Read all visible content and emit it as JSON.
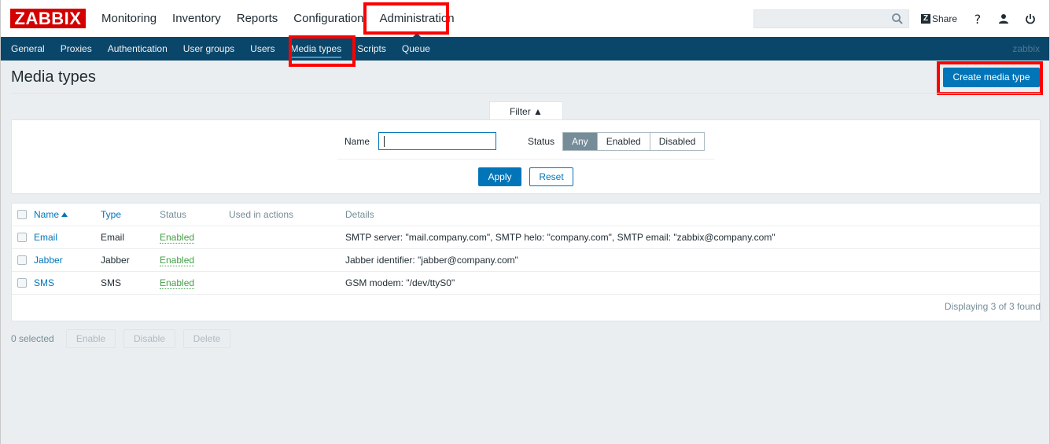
{
  "logo": "ZABBIX",
  "main_menu": [
    {
      "label": "Monitoring"
    },
    {
      "label": "Inventory"
    },
    {
      "label": "Reports"
    },
    {
      "label": "Configuration"
    },
    {
      "label": "Administration",
      "active": true
    }
  ],
  "header": {
    "search_value": "",
    "share_label": "Share",
    "help_label": "?",
    "icons": [
      "search-icon",
      "zabbix-share-icon",
      "help-icon",
      "user-icon",
      "logout-icon"
    ]
  },
  "sub_menu": [
    {
      "label": "General"
    },
    {
      "label": "Proxies"
    },
    {
      "label": "Authentication"
    },
    {
      "label": "User groups"
    },
    {
      "label": "Users"
    },
    {
      "label": "Media types",
      "active": true
    },
    {
      "label": "Scripts"
    },
    {
      "label": "Queue"
    }
  ],
  "server_name": "zabbix",
  "page": {
    "title": "Media types",
    "create_button": "Create media type"
  },
  "filter": {
    "tab_label": "Filter ▲",
    "name_label": "Name",
    "name_value": "",
    "status_label": "Status",
    "status_options": [
      "Any",
      "Enabled",
      "Disabled"
    ],
    "status_selected": "Any",
    "apply_label": "Apply",
    "reset_label": "Reset"
  },
  "table": {
    "columns": [
      "Name",
      "Type",
      "Status",
      "Used in actions",
      "Details"
    ],
    "sort_column": "Name",
    "rows": [
      {
        "name": "Email",
        "type": "Email",
        "status": "Enabled",
        "used_in_actions": "",
        "details": "SMTP server: \"mail.company.com\", SMTP helo: \"company.com\", SMTP email: \"zabbix@company.com\""
      },
      {
        "name": "Jabber",
        "type": "Jabber",
        "status": "Enabled",
        "used_in_actions": "",
        "details": "Jabber identifier: \"jabber@company.com\""
      },
      {
        "name": "SMS",
        "type": "SMS",
        "status": "Enabled",
        "used_in_actions": "",
        "details": "GSM modem: \"/dev/ttyS0\""
      }
    ],
    "footer": "Displaying 3 of 3 found"
  },
  "mass_actions": {
    "selected_text": "0 selected",
    "enable_label": "Enable",
    "disable_label": "Disable",
    "delete_label": "Delete"
  },
  "colors": {
    "brand": "#d40000",
    "nav": "#0a466a",
    "accent": "#0275b8",
    "enabled": "#429e47",
    "highlight": "#ff0000"
  }
}
